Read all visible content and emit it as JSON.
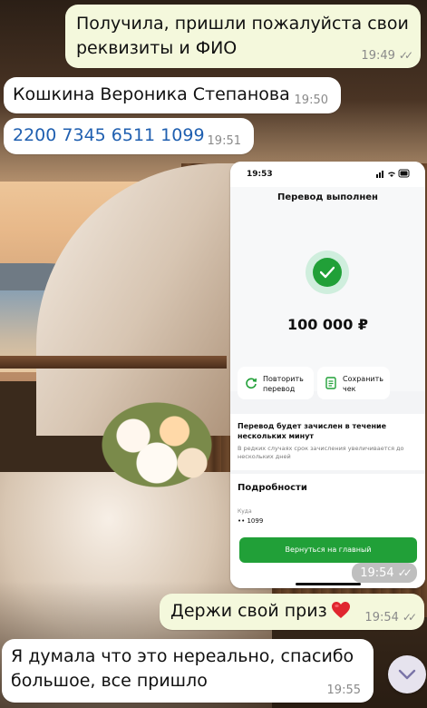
{
  "messages": {
    "m1": {
      "text": "Получила, пришли пожалуйста свои реквизиты и ФИО",
      "time": "19:49",
      "direction": "outgoing"
    },
    "m2": {
      "text": "Кошкина Вероника Степанова",
      "time": "19:50",
      "direction": "incoming"
    },
    "m3": {
      "text": "2200 7345 6511 1099",
      "time": "19:51",
      "direction": "incoming"
    },
    "m4": {
      "time": "19:54",
      "direction": "outgoing"
    },
    "m5": {
      "text": "Держи свой приз",
      "time": "19:54",
      "direction": "outgoing"
    },
    "m6": {
      "text": "Я думала что это нереально, спасибо большое, все пришло",
      "time": "19:55",
      "direction": "incoming"
    }
  },
  "screenshot": {
    "status_time": "19:53",
    "title": "Перевод выполнен",
    "amount": "100 000 ₽",
    "repeat_label": "Повторить перевод",
    "save_label": "Сохранить чек",
    "info_heading": "Перевод будет зачислен в течение нескольких минут",
    "info_sub": "В редких случаях срок зачисления увеличивается до нескольких дней",
    "details_heading": "Подробности",
    "to_label": "Куда",
    "to_value": "•• 1099",
    "back_button": "Вернуться на главный"
  },
  "icons": {
    "read_ticks": "double-check-icon",
    "heart": "red-heart-icon",
    "scroll": "chevron-down-icon",
    "success": "check-circle-icon",
    "repeat": "repeat-icon",
    "receipt": "receipt-icon"
  },
  "colors": {
    "outgoing_bubble": "#f4f8dc",
    "incoming_bubble": "#ffffff",
    "card_link": "#1f5fb0",
    "sber_green": "#21a038"
  }
}
